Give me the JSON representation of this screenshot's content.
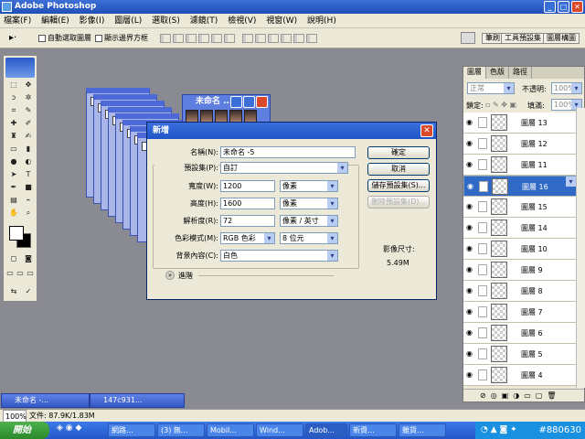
{
  "app": {
    "title": "Adobe Photoshop",
    "min": "_",
    "max": "□",
    "close": "✕"
  },
  "menu": [
    "檔案(F)",
    "編輯(E)",
    "影像(I)",
    "圖層(L)",
    "選取(S)",
    "濾鏡(T)",
    "檢視(V)",
    "視窗(W)",
    "說明(H)"
  ],
  "options": {
    "auto_select": "自動選取圖層",
    "show_bounds": "顯示邊界方框",
    "dock": [
      "筆刷",
      "工具預設集",
      "圖層構圖"
    ]
  },
  "topdoc": {
    "title": "未命名 ..."
  },
  "dialog": {
    "title": "新增",
    "name_label": "名稱(N):",
    "name_value": "未命名 -5",
    "preset_label": "預設集(P):",
    "preset_value": "自訂",
    "width_label": "寬度(W):",
    "width_value": "1200",
    "width_unit": "像素",
    "height_label": "高度(H):",
    "height_value": "1600",
    "height_unit": "像素",
    "res_label": "解析度(R):",
    "res_value": "72",
    "res_unit": "像素 / 英寸",
    "mode_label": "色彩模式(M):",
    "mode_value": "RGB 色彩",
    "depth_value": "8 位元",
    "bg_label": "背景內容(C):",
    "bg_value": "白色",
    "advanced": "進階",
    "ok": "確定",
    "cancel": "取消",
    "save_preset": "儲存預設集(S)...",
    "delete_preset": "刪除預設集(D)...",
    "size_label": "影像尺寸:",
    "size_value": "5.49M"
  },
  "layers": {
    "tabs": [
      "圖層",
      "色版",
      "路徑"
    ],
    "blend": "正常",
    "opacity_label": "不透明:",
    "opacity": "100%",
    "lock_label": "鎖定:",
    "fill_label": "填滿:",
    "fill": "100%",
    "rows": [
      "圖層 13",
      "圖層 12",
      "圖層 11",
      "圖層 16",
      "圖層 15",
      "圖層 14",
      "圖層 10",
      "圖層 9",
      "圖層 8",
      "圖層 7",
      "圖層 6",
      "圖層 5",
      "圖層 4"
    ],
    "selected_index": 3
  },
  "minis": [
    "未命名 -...",
    "147c931..."
  ],
  "status": {
    "zoom": "100%",
    "doc": "文件: 87.9K/1.83M"
  },
  "taskbar": {
    "start": "開始",
    "tasks": [
      "網路...",
      "(3) 無...",
      "Mobil...",
      "Wind...",
      "Adob...",
      "新資...",
      "雜貨..."
    ],
    "tray": "#880630"
  }
}
